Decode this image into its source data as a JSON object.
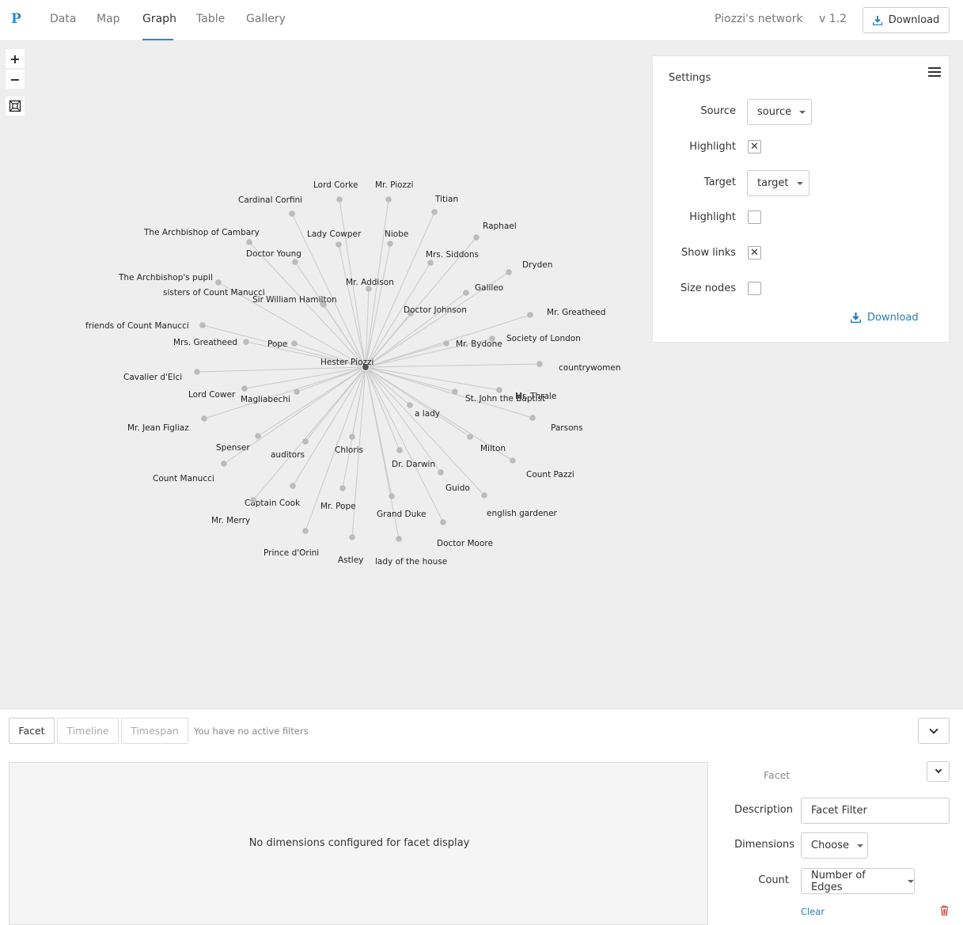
{
  "nav": {
    "logo": "P",
    "tabs": [
      {
        "label": "Data"
      },
      {
        "label": "Map"
      },
      {
        "label": "Graph"
      },
      {
        "label": "Table"
      },
      {
        "label": "Gallery"
      }
    ],
    "active_tab": "Graph",
    "project_name": "Piozzi's network",
    "version": "v 1.2",
    "download_label": "Download"
  },
  "zoom": {
    "in": "+",
    "out": "−"
  },
  "graph": {
    "center": "Hester Piozzi",
    "nodes": [
      {
        "label": "Lord Corke"
      },
      {
        "label": "Mr. Piozzi"
      },
      {
        "label": "Cardinal Corfini"
      },
      {
        "label": "Titian"
      },
      {
        "label": "Raphael"
      },
      {
        "label": "The Archbishop of Cambary"
      },
      {
        "label": "Lady Cowper"
      },
      {
        "label": "Niobe"
      },
      {
        "label": "Doctor Young"
      },
      {
        "label": "Mrs. Siddons"
      },
      {
        "label": "Dryden"
      },
      {
        "label": "The Archbishop's pupil"
      },
      {
        "label": "Mr. Addison"
      },
      {
        "label": "sisters of Count Manucci"
      },
      {
        "label": "Galileo"
      },
      {
        "label": "Sir William Hamilton"
      },
      {
        "label": "Doctor Johnson"
      },
      {
        "label": "Mr. Greatheed"
      },
      {
        "label": "friends of Count Manucci"
      },
      {
        "label": "Society of London"
      },
      {
        "label": "Mrs. Greatheed"
      },
      {
        "label": "Pope"
      },
      {
        "label": "Mr. Bydone"
      },
      {
        "label": "countrywomen"
      },
      {
        "label": "Cavalier d'Elci"
      },
      {
        "label": "Lord Cower"
      },
      {
        "label": "Mr. Thrale"
      },
      {
        "label": "St. John the Baptist"
      },
      {
        "label": "Magliabechi"
      },
      {
        "label": "a lady"
      },
      {
        "label": "Mr. Jean Figliaz"
      },
      {
        "label": "Parsons"
      },
      {
        "label": "Spenser"
      },
      {
        "label": "Chloris"
      },
      {
        "label": "Milton"
      },
      {
        "label": "auditors"
      },
      {
        "label": "Dr. Darwin"
      },
      {
        "label": "Count Pazzi"
      },
      {
        "label": "Count Manucci"
      },
      {
        "label": "Guido"
      },
      {
        "label": "Captain Cook"
      },
      {
        "label": "Mr. Pope"
      },
      {
        "label": "english gardener"
      },
      {
        "label": "Grand Duke"
      },
      {
        "label": "Mr. Merry"
      },
      {
        "label": "Doctor Moore"
      },
      {
        "label": "Prince d'Orini"
      },
      {
        "label": "Astley"
      },
      {
        "label": "lady of the house"
      }
    ]
  },
  "settings": {
    "title": "Settings",
    "source_label": "Source",
    "source_value": "source",
    "highlight1_label": "Highlight",
    "highlight1_checked": "✕",
    "target_label": "Target",
    "target_value": "target",
    "highlight2_label": "Highlight",
    "show_links_label": "Show links",
    "show_links_checked": "✕",
    "size_nodes_label": "Size nodes",
    "download_label": "Download"
  },
  "filterbar": {
    "tabs": [
      {
        "label": "Facet"
      },
      {
        "label": "Timeline"
      },
      {
        "label": "Timespan"
      }
    ],
    "status": "You have no active filters"
  },
  "facet": {
    "empty_message": "No dimensions configured for facet display",
    "side_title": "Facet",
    "description_label": "Description",
    "description_value": "Facet Filter",
    "dimensions_label": "Dimensions",
    "dimensions_value": "Choose",
    "count_label": "Count",
    "count_value": "Number of Edges",
    "clear_label": "Clear"
  },
  "colors": {
    "accent": "#2a8cc8",
    "link": "#2a7ab8",
    "graph_bg": "#eeeeee",
    "node": "#bbbbbb",
    "edge": "#c8c8c8",
    "delete": "#cc3333"
  }
}
